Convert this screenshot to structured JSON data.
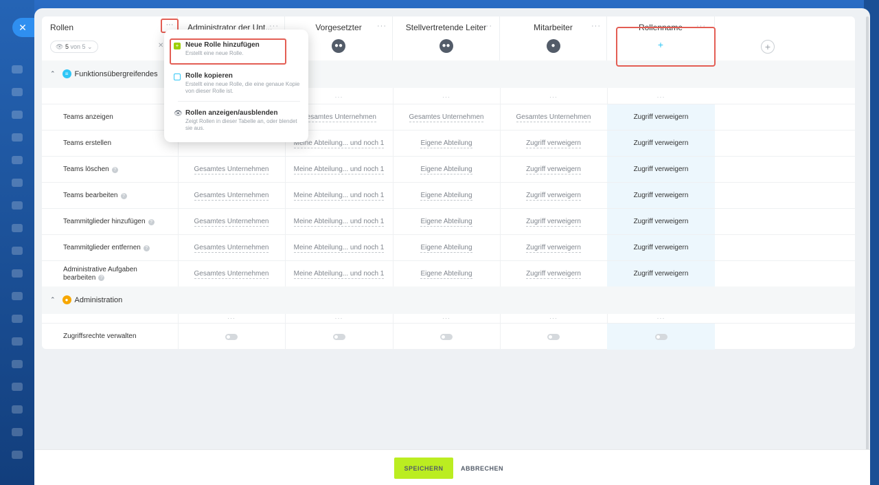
{
  "header": {
    "roles_title": "Rollen",
    "counter_value": "5",
    "counter_suffix": "von 5",
    "columns": [
      {
        "label": "Administrator der Unt...",
        "icon": "more-dots-icon"
      },
      {
        "label": "Vorgesetzter",
        "icon": "group-avatar-icon"
      },
      {
        "label": "Stellvertretende Leiter",
        "icon": "group-avatar-icon"
      },
      {
        "label": "Mitarbeiter",
        "icon": "user-avatar-icon"
      },
      {
        "label": "Rollenname",
        "icon": "plus-icon"
      }
    ],
    "dots": "···",
    "plus": "+"
  },
  "sections": [
    {
      "title": "Funktionsübergreifendes",
      "icon_color": "#2fc6f6",
      "rows": [
        {
          "label": "Teams anzeigen",
          "help": false,
          "values": [
            "",
            "Gesamtes Unternehmen",
            "Gesamtes Unternehmen",
            "Gesamtes Unternehmen",
            "Zugriff verweigern"
          ]
        },
        {
          "label": "Teams erstellen",
          "help": false,
          "values": [
            "",
            "Meine Abteilung... und noch 1",
            "Eigene Abteilung",
            "Zugriff verweigern",
            "Zugriff verweigern"
          ]
        },
        {
          "label": "Teams löschen",
          "help": true,
          "values": [
            "Gesamtes Unternehmen",
            "Meine Abteilung... und noch 1",
            "Eigene Abteilung",
            "Zugriff verweigern",
            "Zugriff verweigern"
          ]
        },
        {
          "label": "Teams bearbeiten",
          "help": true,
          "values": [
            "Gesamtes Unternehmen",
            "Meine Abteilung... und noch 1",
            "Eigene Abteilung",
            "Zugriff verweigern",
            "Zugriff verweigern"
          ]
        },
        {
          "label": "Teammitglieder hinzufügen",
          "help": true,
          "values": [
            "Gesamtes Unternehmen",
            "Meine Abteilung... und noch 1",
            "Eigene Abteilung",
            "Zugriff verweigern",
            "Zugriff verweigern"
          ]
        },
        {
          "label": "Teammitglieder entfernen",
          "help": true,
          "values": [
            "Gesamtes Unternehmen",
            "Meine Abteilung... und noch 1",
            "Eigene Abteilung",
            "Zugriff verweigern",
            "Zugriff verweigern"
          ]
        },
        {
          "label": "Administrative Aufgaben bearbeiten",
          "help": true,
          "values": [
            "Gesamtes Unternehmen",
            "Meine Abteilung... und noch 1",
            "Eigene Abteilung",
            "Zugriff verweigern",
            "Zugriff verweigern"
          ]
        }
      ]
    },
    {
      "title": "Administration",
      "icon_color": "#f7a700",
      "rows": [
        {
          "label": "Zugriffsrechte verwalten",
          "toggle": true
        }
      ]
    }
  ],
  "menu": {
    "items": [
      {
        "title": "Neue Rolle hinzufügen",
        "desc": "Erstellt eine neue Rolle."
      },
      {
        "title": "Rolle kopieren",
        "desc": "Erstellt eine neue Rolle, die eine genaue Kopie von dieser Rolle ist."
      },
      {
        "title": "Rollen anzeigen/ausblenden",
        "desc": "Zeigt Rollen in dieser Tabelle an, oder blendet sie aus."
      }
    ]
  },
  "footer": {
    "save_label": "SPEICHERN",
    "cancel_label": "ABBRECHEN"
  },
  "colors": {
    "accent_green": "#bbed21",
    "highlight_red": "#e35d53",
    "highlight_cell": "#edf7fd"
  }
}
